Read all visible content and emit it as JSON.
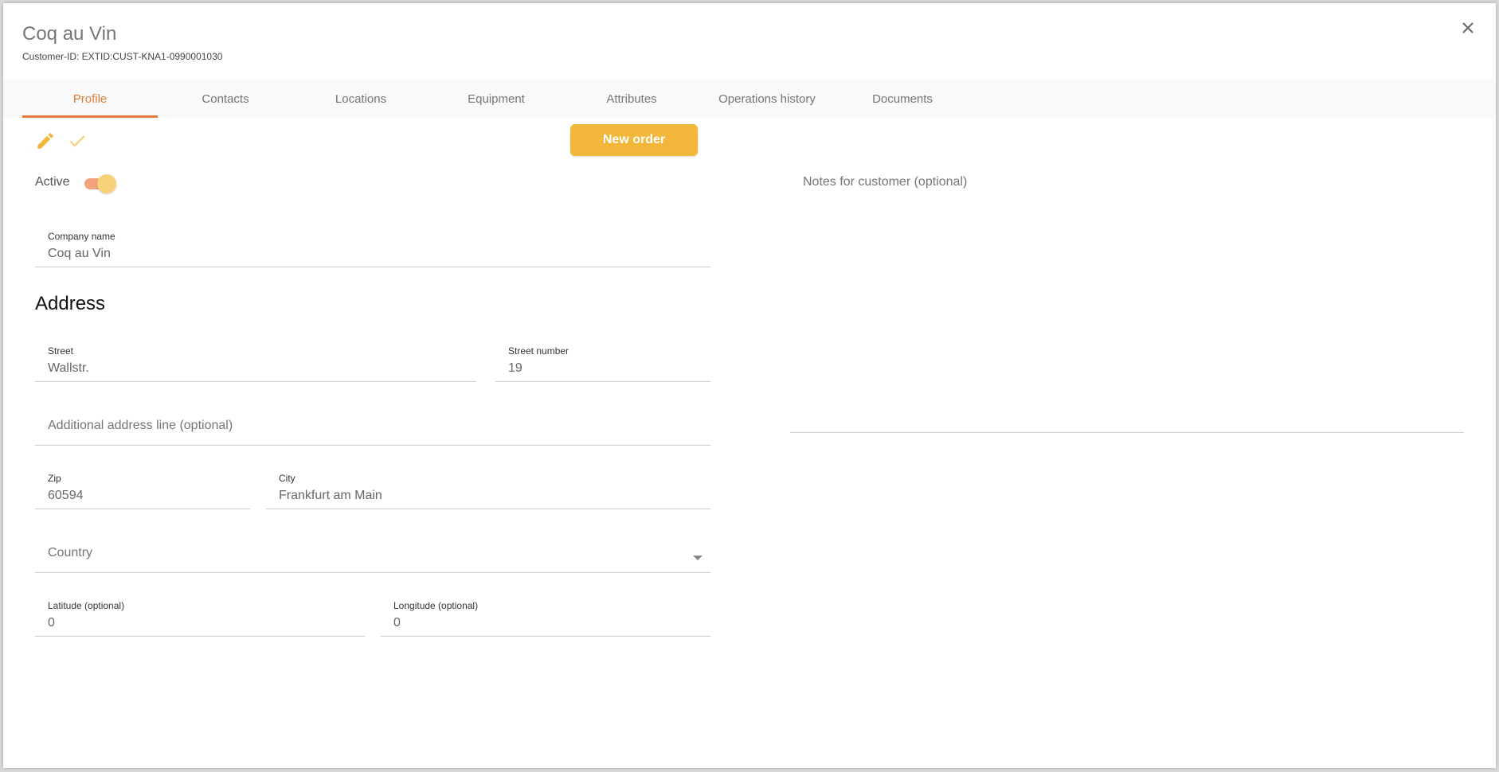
{
  "header": {
    "title": "Coq au Vin",
    "subtitle": "Customer-ID: EXTID:CUST-KNA1-0990001030"
  },
  "tabs": [
    {
      "label": "Profile",
      "active": true
    },
    {
      "label": "Contacts",
      "active": false
    },
    {
      "label": "Locations",
      "active": false
    },
    {
      "label": "Equipment",
      "active": false
    },
    {
      "label": "Attributes",
      "active": false
    },
    {
      "label": "Operations history",
      "active": false
    },
    {
      "label": "Documents",
      "active": false
    }
  ],
  "toolbar": {
    "edit_icon": "pencil-icon",
    "confirm_icon": "check-icon",
    "new_order_label": "New order"
  },
  "status": {
    "active_label": "Active",
    "active_on": true
  },
  "form": {
    "company_name": {
      "label": "Company name",
      "value": "Coq au Vin"
    },
    "address_heading": "Address",
    "street": {
      "label": "Street",
      "value": "Wallstr."
    },
    "street_number": {
      "label": "Street number",
      "value": "19"
    },
    "additional_line": {
      "placeholder": "Additional address line (optional)"
    },
    "zip": {
      "label": "Zip",
      "value": "60594"
    },
    "city": {
      "label": "City",
      "value": "Frankfurt am Main"
    },
    "country": {
      "placeholder": "Country"
    },
    "latitude": {
      "label": "Latitude (optional)",
      "value": "0"
    },
    "longitude": {
      "label": "Longitude (optional)",
      "value": "0"
    }
  },
  "notes": {
    "placeholder": "Notes for customer (optional)"
  },
  "colors": {
    "accent": "#e07b39",
    "button": "#f2b63b",
    "toggle_track": "#f2a27e",
    "toggle_thumb": "#f7d27a"
  }
}
